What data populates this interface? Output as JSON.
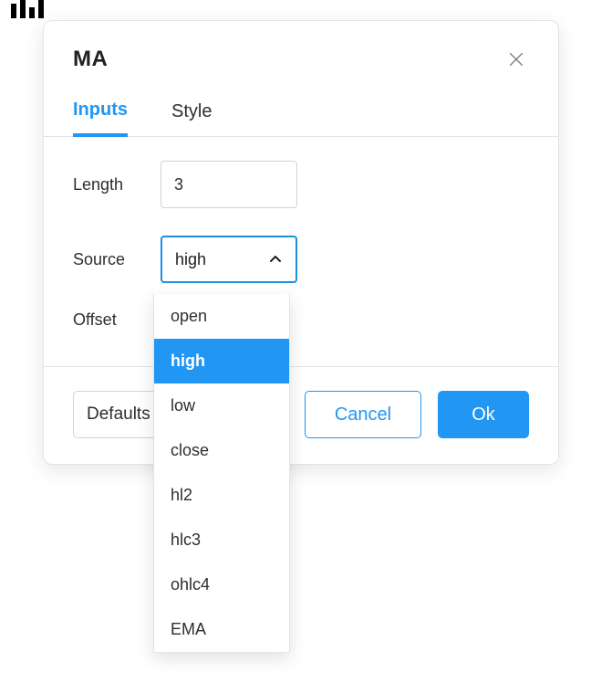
{
  "dialog": {
    "title": "MA",
    "tabs": {
      "inputs": "Inputs",
      "style": "Style"
    },
    "active_tab": "inputs",
    "fields": {
      "length": {
        "label": "Length",
        "value": "3"
      },
      "source": {
        "label": "Source",
        "value": "high"
      },
      "offset": {
        "label": "Offset"
      }
    },
    "source_options": [
      "open",
      "high",
      "low",
      "close",
      "hl2",
      "hlc3",
      "ohlc4",
      "EMA"
    ],
    "buttons": {
      "defaults": "Defaults",
      "cancel": "Cancel",
      "ok": "Ok"
    }
  },
  "colors": {
    "accent": "#2196f3",
    "border": "#e1e4e8",
    "text": "#2b2f33"
  }
}
